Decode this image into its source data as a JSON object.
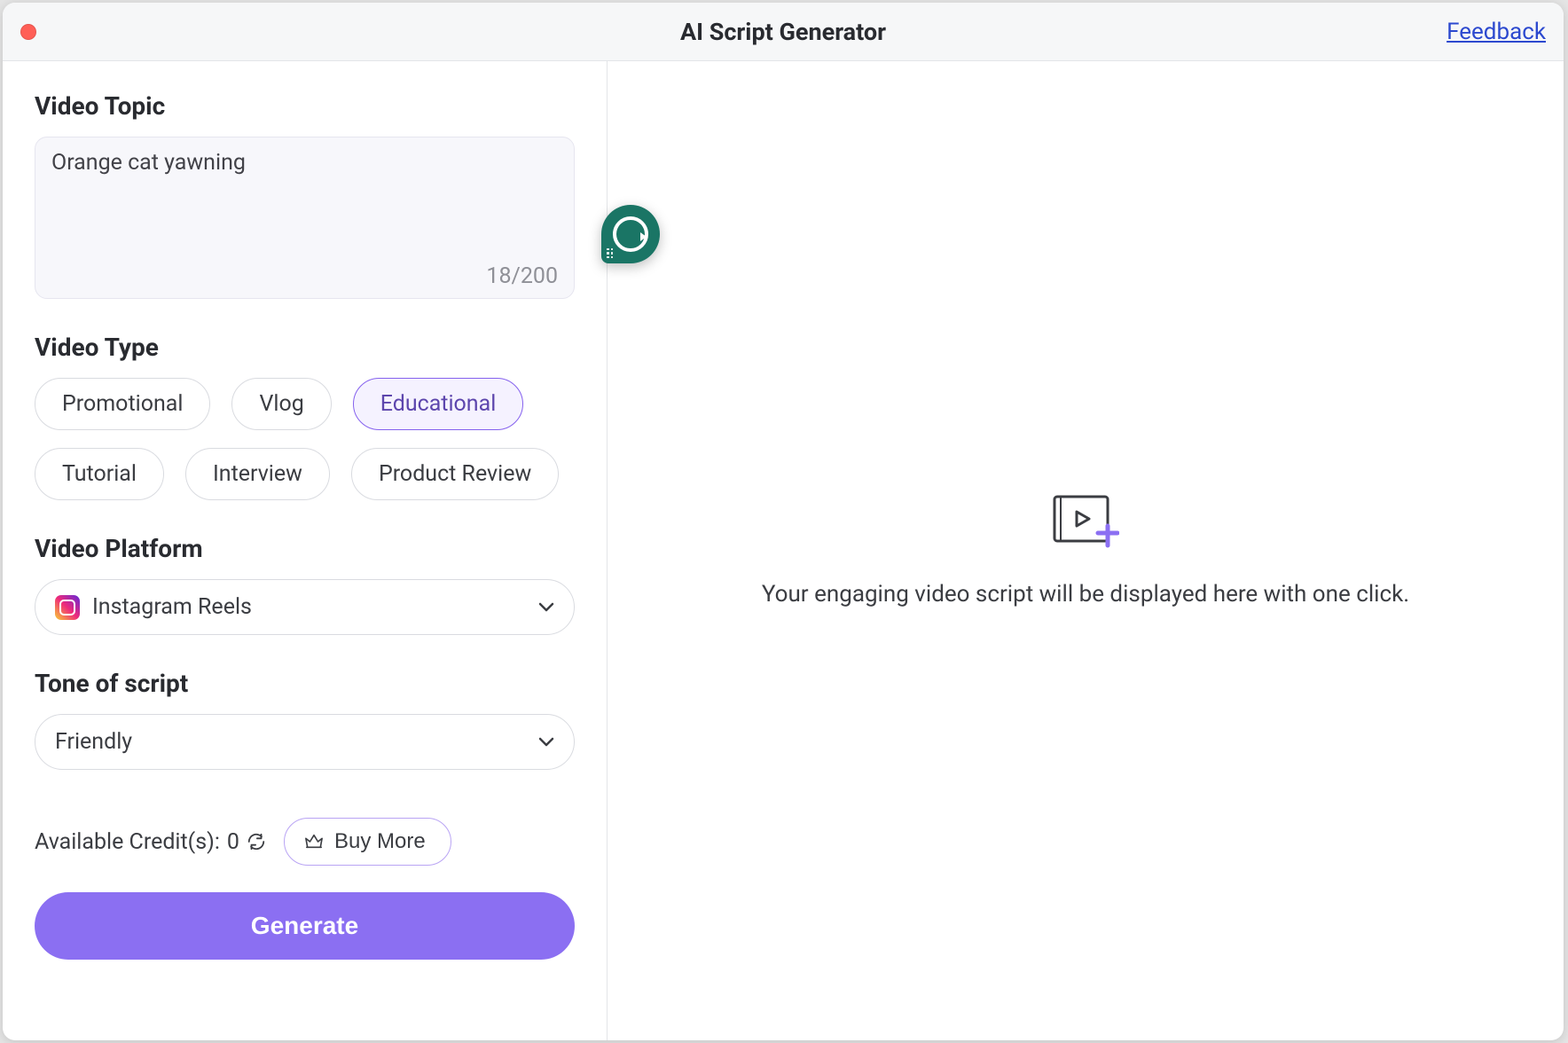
{
  "header": {
    "title": "AI Script Generator",
    "feedback": "Feedback"
  },
  "videoTopic": {
    "heading": "Video Topic",
    "value": "Orange cat yawning",
    "charCount": "18/200"
  },
  "videoType": {
    "heading": "Video Type",
    "options": {
      "promotional": "Promotional",
      "vlog": "Vlog",
      "educational": "Educational",
      "tutorial": "Tutorial",
      "interview": "Interview",
      "productReview": "Product Review"
    },
    "selected": "Educational"
  },
  "videoPlatform": {
    "heading": "Video Platform",
    "value": "Instagram Reels"
  },
  "tone": {
    "heading": "Tone of script",
    "value": "Friendly"
  },
  "credits": {
    "label": "Available Credit(s): ",
    "value": "0",
    "buyMore": "Buy More"
  },
  "generate": {
    "label": "Generate"
  },
  "preview": {
    "text": "Your engaging video script will be displayed here with one click."
  }
}
